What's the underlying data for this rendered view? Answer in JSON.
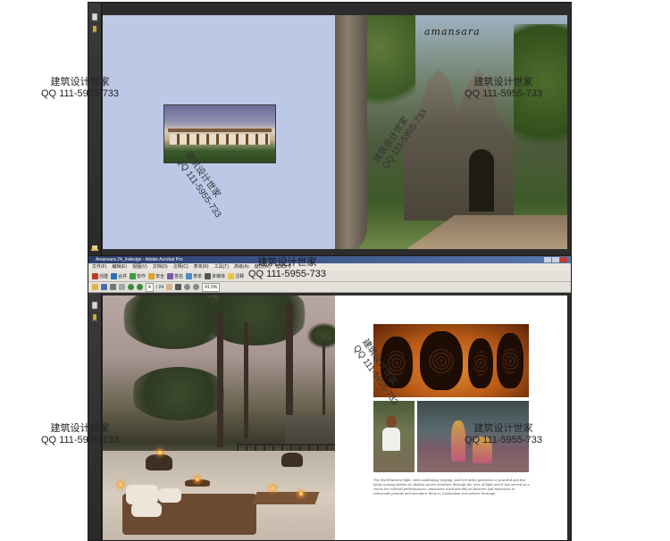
{
  "watermark": {
    "name": "建筑设计世家",
    "qq": "QQ 111-5955-733"
  },
  "top_window": {
    "right_page_brand": "amansara"
  },
  "bottom_window": {
    "title": "Amansara 24_Indesign - Adobe Acrobat Pro",
    "menu": [
      "文件(F)",
      "编辑(E)",
      "视图(V)",
      "文档(D)",
      "注释(C)",
      "表单(R)",
      "工具(T)",
      "高级(A)",
      "窗口(W)",
      "帮助(H)"
    ],
    "toolbar_create": "创建",
    "toolbar_combine": "合并",
    "toolbar_collaborate": "协作",
    "toolbar_secure": "安全",
    "toolbar_sign": "签名",
    "toolbar_forms": "表单",
    "toolbar_multimedia": "多媒体",
    "toolbar_comment": "注释",
    "page_number": "4",
    "page_count": "/ 24",
    "zoom": "41.5%",
    "caption": "The dwell-lantern-light, with undulating wisping, and live-ables generates a peaceful and fun-ladig ciorang shades as shadow moves treatises through the cave of light and it has served as a venue for cultural performances. Amansara work introduced dancers and musicians to rehearsals periods and introduce them to Cambodian rich artistic heritage."
  },
  "colors": {
    "accent": "#2a3e6c",
    "top_left_page": "#bcc8e6",
    "window_frame": "#2c2c2c"
  }
}
